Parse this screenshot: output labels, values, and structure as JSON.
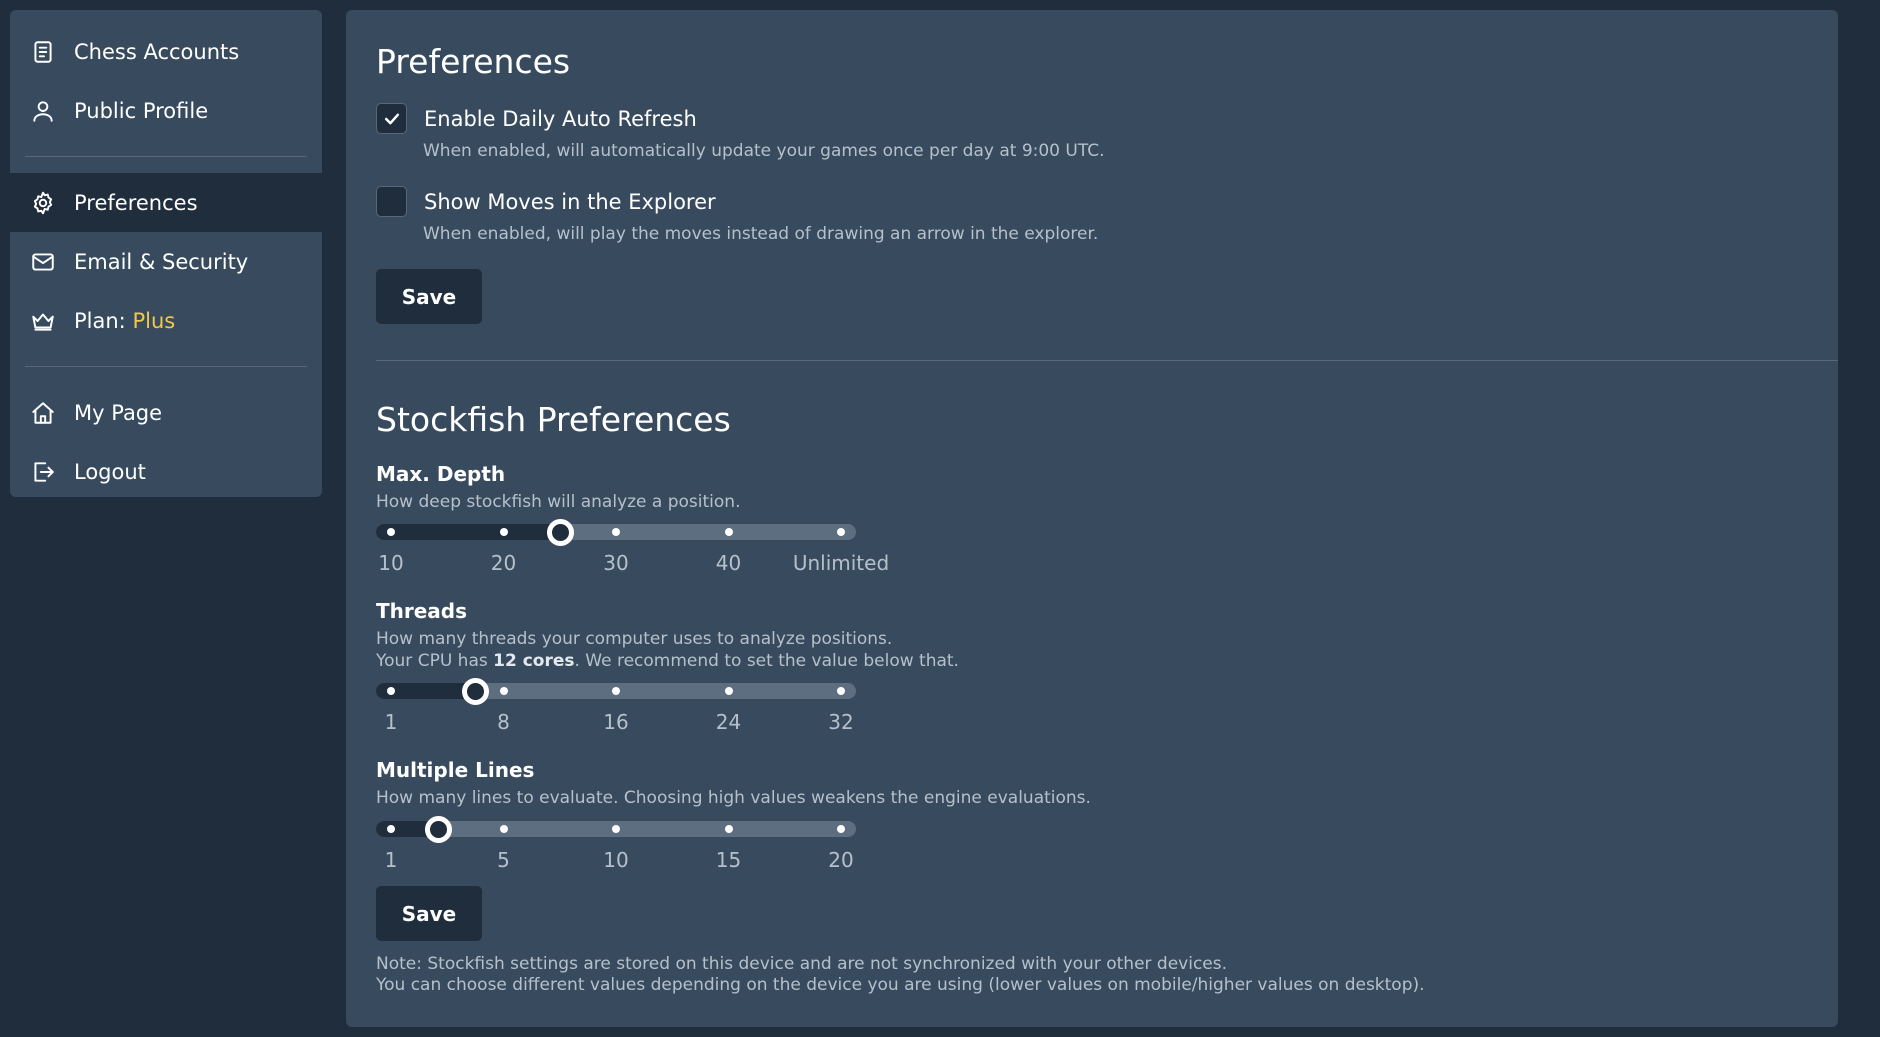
{
  "sidebar": {
    "items": [
      {
        "label": "Chess Accounts",
        "icon": "document-icon"
      },
      {
        "label": "Public Profile",
        "icon": "user-icon"
      },
      {
        "label": "Preferences",
        "icon": "gear-icon",
        "active": true
      },
      {
        "label": "Email & Security",
        "icon": "mail-icon"
      },
      {
        "label": "Plan: ",
        "accent": "Plus",
        "icon": "crown-icon"
      },
      {
        "label": "My Page",
        "icon": "home-icon"
      },
      {
        "label": "Logout",
        "icon": "logout-icon"
      }
    ]
  },
  "preferences": {
    "title": "Preferences",
    "auto_refresh": {
      "label": "Enable Daily Auto Refresh",
      "checked": true,
      "help": "When enabled, will automatically update your games once per day at 9:00 UTC."
    },
    "show_moves": {
      "label": "Show Moves in the Explorer",
      "checked": false,
      "help": "When enabled, will play the moves instead of drawing an arrow in the explorer."
    },
    "save_label": "Save"
  },
  "stockfish": {
    "title": "Stockfish Preferences",
    "depth": {
      "label": "Max. Depth",
      "help": "How deep stockfish will analyze a position.",
      "ticks": [
        "10",
        "20",
        "30",
        "40",
        "Unlimited"
      ],
      "value_fraction": 0.375
    },
    "threads": {
      "label": "Threads",
      "help_line1": "How many threads your computer uses to analyze positions.",
      "help_line2_pre": "Your CPU has ",
      "help_line2_bold": "12 cores",
      "help_line2_post": ". We recommend to set the value below that.",
      "ticks": [
        "1",
        "8",
        "16",
        "24",
        "32"
      ],
      "value_fraction": 0.1875
    },
    "lines": {
      "label": "Multiple Lines",
      "help": "How many lines to evaluate. Choosing high values weakens the engine evaluations.",
      "ticks": [
        "1",
        "5",
        "10",
        "15",
        "20"
      ],
      "value_fraction": 0.105
    },
    "save_label": "Save",
    "note_line1": "Note: Stockfish settings are stored on this device and are not synchronized with your other devices.",
    "note_line2": "You can choose different values depending on the device you are using (lower values on mobile/higher values on desktop)."
  },
  "colors": {
    "background": "#1f2d3c",
    "panel": "#384b5e",
    "accent": "#f0c94b"
  }
}
